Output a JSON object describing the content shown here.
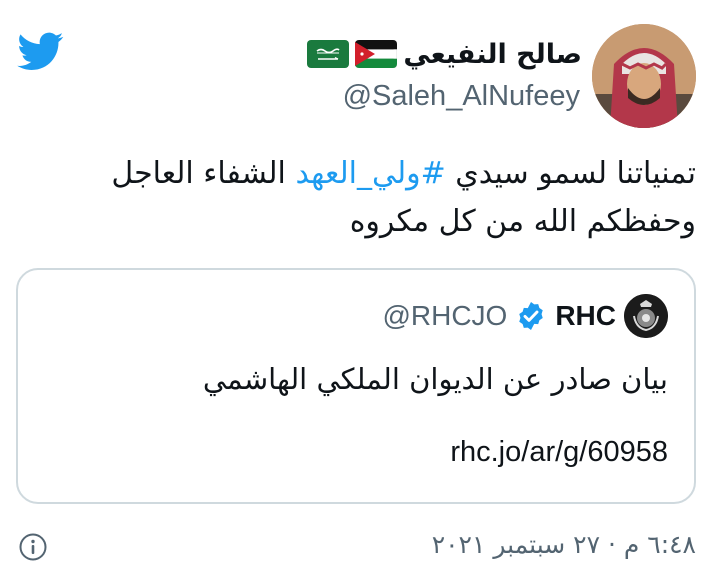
{
  "colors": {
    "twitter_blue": "#1d9bf0",
    "verified_blue": "#1d9bf0",
    "secondary_text": "#536471",
    "border": "#cfd9de",
    "text": "#0f1419"
  },
  "header": {
    "logo_icon": "twitter-bird-icon",
    "display_name": "صالح النفيعي",
    "flags": [
      "jordan-flag-icon",
      "saudi-flag-icon"
    ],
    "handle": "@Saleh_AlNufeey"
  },
  "tweet": {
    "text_before": "تمنياتنا لسمو سيدي ",
    "hashtag": "#ولي_العهد",
    "text_after": " الشفاء العاجل وحفظكم الله من كل مكروه"
  },
  "quote": {
    "name": "RHC",
    "verified_icon": "verified-badge-icon",
    "handle": "@RHCJO",
    "text": "بيان صادر عن الديوان الملكي الهاشمي",
    "link": "rhc.jo/ar/g/60958"
  },
  "footer": {
    "timestamp": "٦:٤٨ م · ٢٧ سبتمبر ٢٠٢١",
    "info_icon": "info-icon"
  }
}
